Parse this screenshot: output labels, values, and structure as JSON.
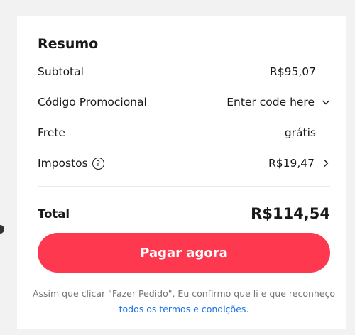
{
  "summary": {
    "title": "Resumo",
    "subtotal": {
      "label": "Subtotal",
      "value": "R$95,07"
    },
    "promo": {
      "label": "Código Promocional",
      "value": "Enter code here"
    },
    "shipping": {
      "label": "Frete",
      "value": "grátis"
    },
    "taxes": {
      "label": "Impostos",
      "value": "R$19,47"
    },
    "total": {
      "label": "Total",
      "value": "R$114,54"
    }
  },
  "pay_button_label": "Pagar agora",
  "disclaimer": {
    "text_part1": "Assim que clicar \"Fazer Pedido\", Eu confirmo que li e que reconheço ",
    "link_text": "todos os termos e condições",
    "text_part2": "."
  },
  "icons": {
    "help": "question-circle-icon",
    "promo_chevron": "chevron-down-icon",
    "taxes_chevron": "chevron-right-icon"
  },
  "colors": {
    "accent": "#fd384f",
    "link": "#1a73e8",
    "muted_text": "#757575"
  }
}
